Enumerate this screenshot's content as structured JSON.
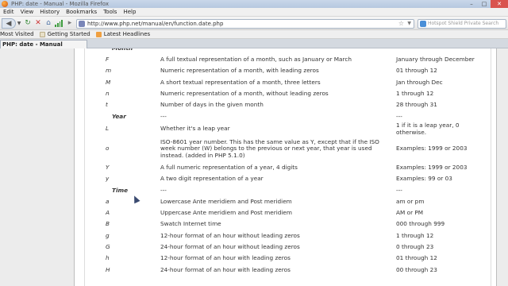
{
  "window": {
    "title": "PHP: date - Manual - Mozilla Firefox",
    "buttons": {
      "minimize": "–",
      "maximize": "□",
      "close": "✕"
    }
  },
  "menu": [
    "Edit",
    "View",
    "History",
    "Bookmarks",
    "Tools",
    "Help"
  ],
  "nav": {
    "url": "http://www.php.net/manual/en/function.date.php",
    "search_placeholder": "Hotspot Shield Private Search"
  },
  "bookmarks": [
    {
      "label": "Most Visited",
      "color": "#6a8fc9"
    },
    {
      "label": "Getting Started",
      "color": "#e8e0c8"
    },
    {
      "label": "Latest Headlines",
      "color": "#f0a040"
    }
  ],
  "tab": {
    "label": "PHP: date - Manual"
  },
  "table": {
    "rows": [
      {
        "type": "section",
        "c1": "Month",
        "c2": "",
        "c3": ""
      },
      {
        "type": "row",
        "c1": "F",
        "c2": "A full textual representation of a month, such as January or March",
        "c3": "January through December"
      },
      {
        "type": "row",
        "c1": "m",
        "c2": "Numeric representation of a month, with leading zeros",
        "c3": "01 through 12"
      },
      {
        "type": "row",
        "c1": "M",
        "c2": "A short textual representation of a month, three letters",
        "c3": "Jan through Dec"
      },
      {
        "type": "row",
        "c1": "n",
        "c2": "Numeric representation of a month, without leading zeros",
        "c3": "1 through 12"
      },
      {
        "type": "row",
        "c1": "t",
        "c2": "Number of days in the given month",
        "c3": "28 through 31"
      },
      {
        "type": "section",
        "c1": "Year",
        "c2": "---",
        "c3": "---"
      },
      {
        "type": "row",
        "c1": "L",
        "c2": "Whether it's a leap year",
        "c3": "1 if it is a leap year, 0 otherwise."
      },
      {
        "type": "tall",
        "c1": "o",
        "c2": "ISO-8601 year number. This has the same value as Y, except that if the ISO week number (W) belongs to the previous or next year, that year is used instead. (added in PHP 5.1.0)",
        "c3": "Examples: 1999 or 2003"
      },
      {
        "type": "row",
        "c1": "Y",
        "c2": "A full numeric representation of a year, 4 digits",
        "c3": "Examples: 1999 or 2003"
      },
      {
        "type": "row",
        "c1": "y",
        "c2": "A two digit representation of a year",
        "c3": "Examples: 99 or 03"
      },
      {
        "type": "section",
        "c1": "Time",
        "c2": "---",
        "c3": "---"
      },
      {
        "type": "row",
        "c1": "a",
        "c2": "Lowercase Ante meridiem and Post meridiem",
        "c3": "am or pm"
      },
      {
        "type": "row",
        "c1": "A",
        "c2": "Uppercase Ante meridiem and Post meridiem",
        "c3": "AM or PM"
      },
      {
        "type": "row",
        "c1": "B",
        "c2": "Swatch Internet time",
        "c3": "000 through 999"
      },
      {
        "type": "row",
        "c1": "g",
        "c2": "12-hour format of an hour without leading zeros",
        "c3": "1 through 12"
      },
      {
        "type": "row",
        "c1": "G",
        "c2": "24-hour format of an hour without leading zeros",
        "c3": "0 through 23"
      },
      {
        "type": "row",
        "c1": "h",
        "c2": "12-hour format of an hour with leading zeros",
        "c3": "01 through 12"
      },
      {
        "type": "row",
        "c1": "H",
        "c2": "24-hour format of an hour with leading zeros",
        "c3": "00 through 23"
      }
    ]
  }
}
